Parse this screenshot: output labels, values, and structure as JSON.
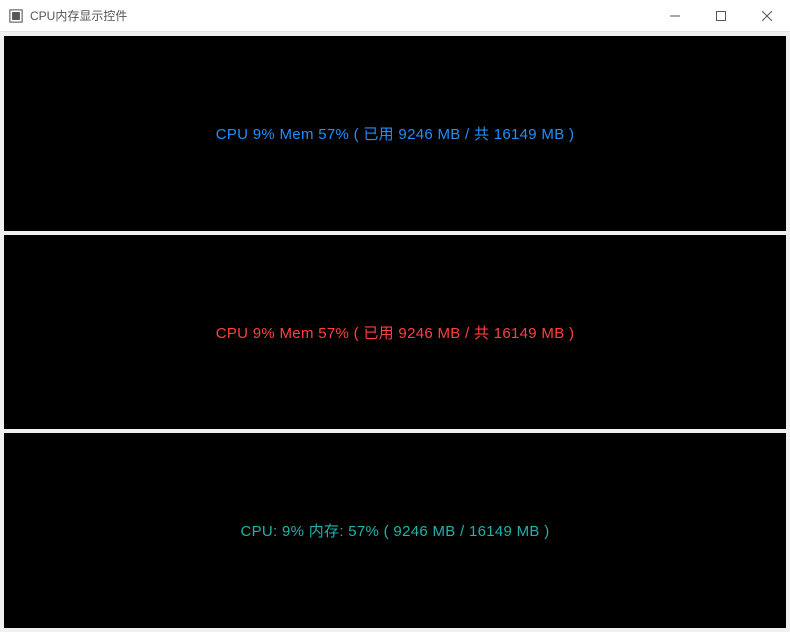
{
  "window": {
    "title": "CPU内存显示控件"
  },
  "panels": [
    {
      "text": "CPU 9%  Mem 57% ( 已用 9246 MB / 共 16149 MB )",
      "color": "blue"
    },
    {
      "text": "CPU 9%  Mem 57% ( 已用 9246 MB / 共 16149 MB )",
      "color": "red"
    },
    {
      "text": "CPU: 9%  内存: 57% ( 9246 MB / 16149 MB )",
      "color": "teal"
    }
  ]
}
